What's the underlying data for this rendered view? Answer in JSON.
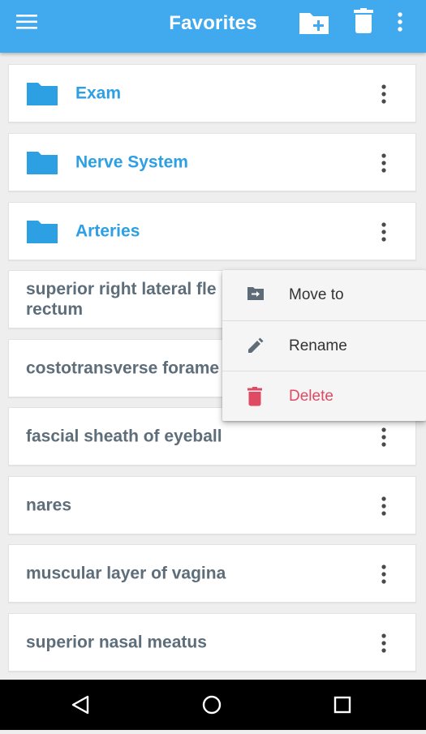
{
  "appbar": {
    "title": "Favorites",
    "menu_icon": "hamburger-menu-icon",
    "new_folder_icon": "create-new-folder-icon",
    "delete_icon": "trash-icon",
    "overflow_icon": "more-vert-icon",
    "color": "#41a9ee"
  },
  "folders": [
    {
      "label": "Exam"
    },
    {
      "label": "Nerve System"
    },
    {
      "label": "Arteries"
    }
  ],
  "items": [
    {
      "label": "superior right lateral fle"
    },
    {
      "label": "costotransverse forame"
    },
    {
      "label": "fascial sheath of eyeball"
    },
    {
      "label": "nares"
    },
    {
      "label": "muscular layer of vagina"
    },
    {
      "label": "superior nasal meatus"
    }
  ],
  "item0_line2": "rectum",
  "context_menu": {
    "move_to": "Move to",
    "rename": "Rename",
    "delete": "Delete",
    "delete_color": "#e04a62"
  },
  "navbar": {
    "back_icon": "back-triangle-icon",
    "home_icon": "home-circle-icon",
    "recents_icon": "recents-square-icon"
  }
}
